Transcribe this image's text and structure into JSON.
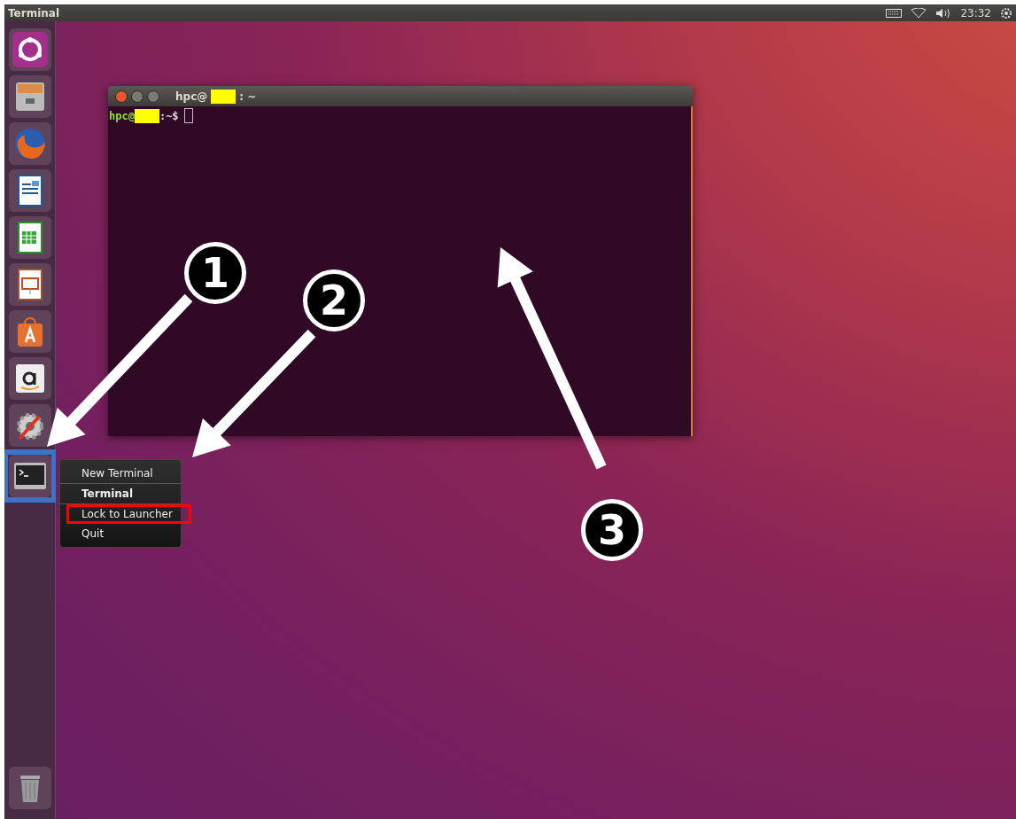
{
  "top_bar": {
    "title": "Terminal",
    "clock": "23:32"
  },
  "launcher": {
    "items": [
      {
        "kind": "dash",
        "selected": false
      },
      {
        "kind": "files",
        "selected": false
      },
      {
        "kind": "browser",
        "selected": false
      },
      {
        "kind": "writer",
        "selected": false
      },
      {
        "kind": "calc",
        "selected": false
      },
      {
        "kind": "impress",
        "selected": false
      },
      {
        "kind": "software",
        "selected": false
      },
      {
        "kind": "amazon",
        "selected": false
      },
      {
        "kind": "settings",
        "selected": false
      },
      {
        "kind": "terminal",
        "selected": true
      }
    ],
    "bottom": {
      "kind": "trash"
    }
  },
  "terminal": {
    "title_user": "hpc@",
    "title_path": ": ~",
    "prompt_user": "hpc@",
    "prompt_path": ":~$"
  },
  "context_menu": {
    "items": [
      {
        "label": "New Terminal",
        "bold": false,
        "highlighted": false,
        "divider_after": true
      },
      {
        "label": "Terminal",
        "bold": true,
        "highlighted": false,
        "divider_after": true
      },
      {
        "label": "Lock to Launcher",
        "bold": false,
        "highlighted": true,
        "divider_after": false
      },
      {
        "label": "Quit",
        "bold": false,
        "highlighted": false,
        "divider_after": false
      }
    ]
  },
  "markers": [
    {
      "label": "1"
    },
    {
      "label": "2"
    },
    {
      "label": "3"
    }
  ]
}
